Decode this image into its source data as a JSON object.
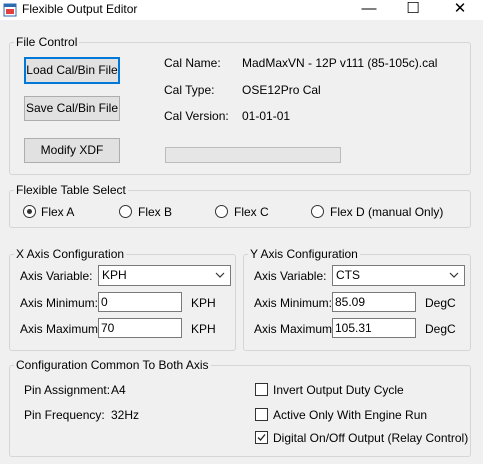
{
  "window": {
    "title": "Flexible Output Editor",
    "minimize_glyph": "—",
    "maximize_glyph": "☐",
    "close_glyph": "✕"
  },
  "file_control": {
    "legend": "File Control",
    "load_button": "Load Cal/Bin File",
    "save_button": "Save Cal/Bin File",
    "modify_button": "Modify XDF",
    "cal_name_label": "Cal Name:",
    "cal_name_value": "MadMaxVN - 12P v111 (85-105c).cal",
    "cal_type_label": "Cal Type:",
    "cal_type_value": "OSE12Pro Cal",
    "cal_version_label": "Cal Version:",
    "cal_version_value": "01-01-01",
    "progress": 0
  },
  "table_select": {
    "legend": "Flexible Table Select",
    "options": [
      {
        "label": "Flex A",
        "checked": true
      },
      {
        "label": "Flex B",
        "checked": false
      },
      {
        "label": "Flex C",
        "checked": false
      },
      {
        "label": "Flex D (manual Only)",
        "checked": false
      }
    ]
  },
  "x_axis": {
    "legend": "X Axis Configuration",
    "variable_label": "Axis Variable:",
    "variable_value": "KPH",
    "min_label": "Axis Minimum:",
    "min_value": "0",
    "min_unit": "KPH",
    "max_label": "Axis Maximum:",
    "max_value": "70",
    "max_unit": "KPH"
  },
  "y_axis": {
    "legend": "Y Axis Configuration",
    "variable_label": "Axis Variable:",
    "variable_value": "CTS",
    "min_label": "Axis Minimum:",
    "min_value": "85.09",
    "min_unit": "DegC",
    "max_label": "Axis Maximum:",
    "max_value": "105.31",
    "max_unit": "DegC"
  },
  "common": {
    "legend": "Configuration Common To Both Axis",
    "pin_assignment_label": "Pin Assignment:",
    "pin_assignment_value": "A4",
    "pin_frequency_label": "Pin Frequency:",
    "pin_frequency_value": "32Hz",
    "checks": [
      {
        "label": "Invert Output Duty Cycle",
        "checked": false
      },
      {
        "label": "Active Only With Engine Run",
        "checked": false
      },
      {
        "label": "Digital On/Off Output (Relay Control)",
        "checked": true
      }
    ]
  }
}
